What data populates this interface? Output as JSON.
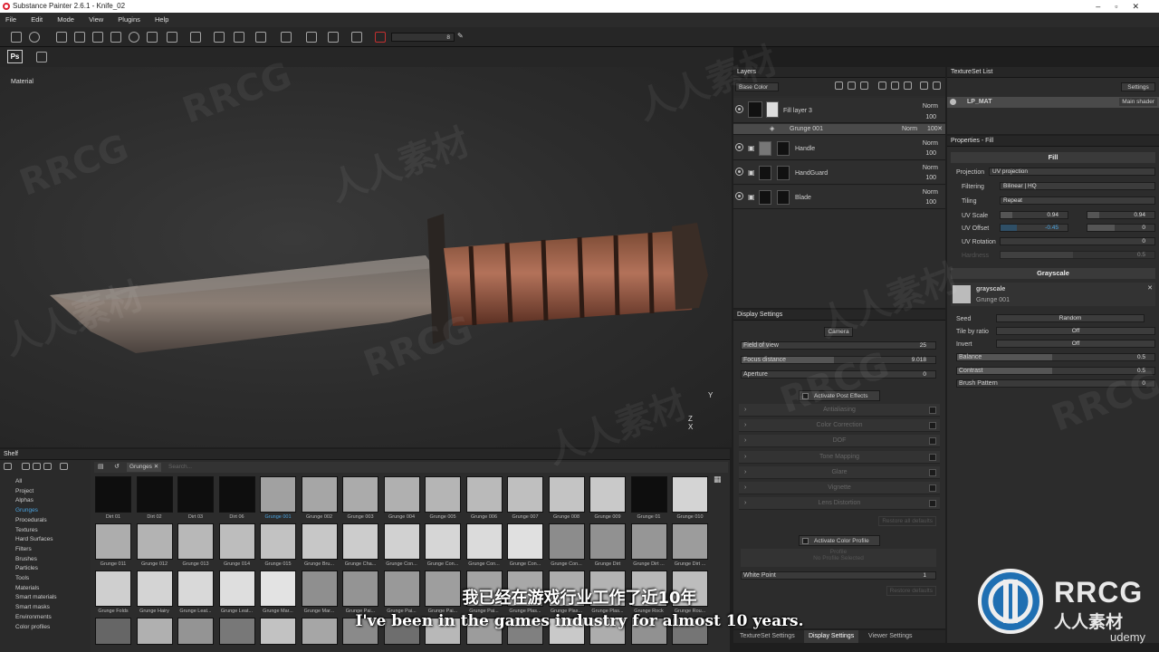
{
  "window": {
    "title": "Substance Painter 2.6.1 - Knife_02"
  },
  "menu": [
    "File",
    "Edit",
    "Mode",
    "View",
    "Plugins",
    "Help"
  ],
  "toolbar": {
    "brush_size": "8",
    "ps_label": "Ps"
  },
  "viewport": {
    "label": "Material",
    "axis": "Z  X",
    "axis_y": "Y"
  },
  "layers": {
    "title": "Layers",
    "channel": "Base Color",
    "items": [
      {
        "name": "Fill layer 3",
        "blend": "Norm",
        "opacity": "100"
      },
      {
        "name": "Grunge 001",
        "blend": "Norm",
        "opacity": "100"
      },
      {
        "name": "Handle",
        "blend": "Norm",
        "opacity": "100"
      },
      {
        "name": "HandGuard",
        "blend": "Norm",
        "opacity": "100"
      },
      {
        "name": "Blade",
        "blend": "Norm",
        "opacity": "100"
      }
    ]
  },
  "texset": {
    "title": "TextureSet List",
    "settings": "Settings",
    "item": "LP_MAT",
    "shader": "Main shader"
  },
  "props": {
    "title": "Properties - Fill",
    "fill": "Fill",
    "projection_label": "Projection",
    "projection": "UV projection",
    "filtering_label": "Filtering",
    "filtering": "Bilinear | HQ",
    "tiling_label": "Tiling",
    "tiling": "Repeat",
    "uvscale_label": "UV Scale",
    "uvscale_a": "0.94",
    "uvscale_b": "0.94",
    "uvoffset_label": "UV Offset",
    "uvoffset_a": "-0.45",
    "uvoffset_b": "0",
    "uvrot_label": "UV Rotation",
    "uvrot": "0",
    "hardness_label": "Hardness",
    "hardness": "0.5",
    "grayscale": "Grayscale",
    "gs_name": "grayscale",
    "gs_sub": "Grunge 001",
    "seed_label": "Seed",
    "seed": "Random",
    "tile_label": "Tile by ratio",
    "tile": "Off",
    "invert_label": "Invert",
    "invert": "Off",
    "balance_label": "Balance",
    "balance": "0.5",
    "contrast_label": "Contrast",
    "contrast": "0.5",
    "brush_label": "Brush Pattern",
    "brush": "0"
  },
  "display": {
    "title": "Display Settings",
    "camera": "Camera",
    "fov_label": "Field of view",
    "fov": "25",
    "focus_label": "Focus distance",
    "focus": "9.018",
    "aperture_label": "Aperture",
    "aperture": "0",
    "post": "Activate Post Effects",
    "effects": [
      "Antialiasing",
      "Color Correction",
      "DOF",
      "Tone Mapping",
      "Glare",
      "Vignette",
      "Lens Distortion"
    ],
    "restore": "Restore all defaults",
    "color_profile": "Activate Color Profile",
    "profile": "Profile",
    "no_profile": "No Profile Selected",
    "white_label": "White Point",
    "white": "1",
    "restore2": "Restore defaults"
  },
  "bottom_tabs": [
    "TextureSet Settings",
    "Display Settings",
    "Viewer Settings"
  ],
  "shelf": {
    "title": "Shelf",
    "filter": "Grunges",
    "search": "Search...",
    "categories": [
      "All",
      "Project",
      "Alphas",
      "Grunges",
      "Procedurals",
      "Textures",
      "Hard Surfaces",
      "Filters",
      "Brushes",
      "Particles",
      "Tools",
      "Materials",
      "Smart materials",
      "Smart masks",
      "Environments",
      "Color profiles"
    ],
    "row1": [
      "Dirt 01",
      "Dirt 02",
      "Dirt 03",
      "Dirt 06",
      "Grunge 001",
      "Grunge 002",
      "Grunge 003",
      "Grunge 004",
      "Grunge 005",
      "Grunge 006",
      "Grunge 007",
      "Grunge 008",
      "Grunge 009",
      "Grunge 01",
      "Grunge 010"
    ],
    "row2": [
      "Grunge 011",
      "Grunge 012",
      "Grunge 013",
      "Grunge 014",
      "Grunge 015",
      "Grunge Bru...",
      "Grunge Cha...",
      "Grunge Con...",
      "Grunge Con...",
      "Grunge Con...",
      "Grunge Con...",
      "Grunge Con...",
      "Grunge Dirt",
      "Grunge Dirt ...",
      "Grunge Dirt ..."
    ],
    "row3": [
      "Grunge Folds",
      "Grunge Hairy",
      "Grunge Leat...",
      "Grunge Leat...",
      "Grunge Mar...",
      "Grunge Mar...",
      "Grunge Pai...",
      "Grunge Pai...",
      "Grunge Pai...",
      "Grunge Pai...",
      "Grunge Plas...",
      "Grunge Plas...",
      "Grunge Plas...",
      "Grunge Rock",
      "Grunge Rou..."
    ]
  },
  "subtitle": {
    "cn": "我已经在游戏行业工作了近10年",
    "en": "I've been in the games industry for almost 10 years."
  },
  "watermark": {
    "brand": "RRCG",
    "cn": "人人素材",
    "udemy": "udemy"
  }
}
